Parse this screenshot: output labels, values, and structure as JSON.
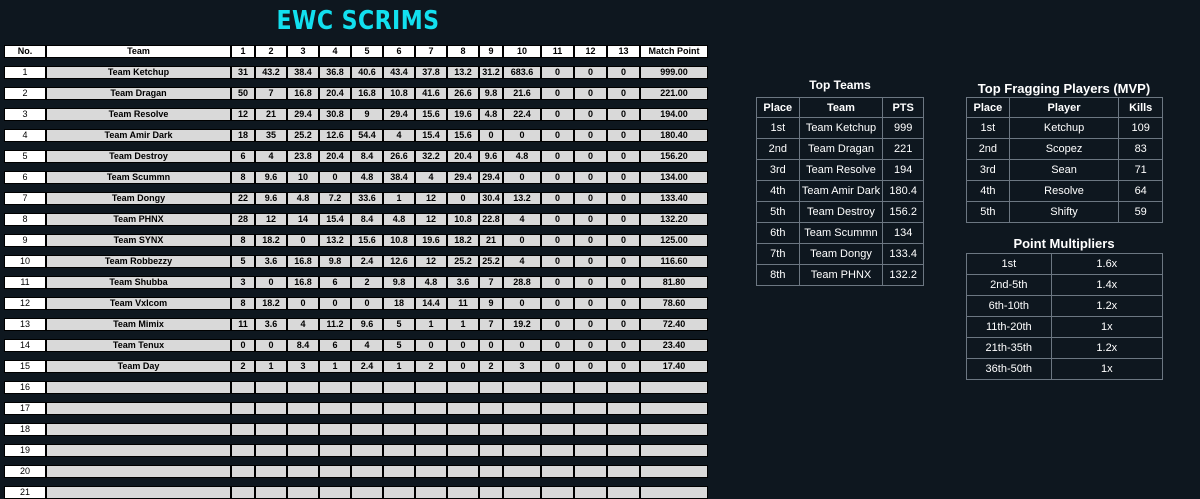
{
  "title": "EWC SCRIMS",
  "standings": {
    "headers": [
      "No.",
      "Team",
      "1",
      "2",
      "3",
      "4",
      "5",
      "6",
      "7",
      "8",
      "9",
      "10",
      "11",
      "12",
      "13",
      "Match Point"
    ],
    "rows": [
      {
        "no": "1",
        "team": "Team Ketchup",
        "g": [
          "31",
          "43.2",
          "38.4",
          "36.8",
          "40.6",
          "43.4",
          "37.8",
          "13.2",
          "31.2",
          "683.6",
          "0",
          "0",
          "0"
        ],
        "mp": "999.00"
      },
      {
        "no": "2",
        "team": "Team Dragan",
        "g": [
          "50",
          "7",
          "16.8",
          "20.4",
          "16.8",
          "10.8",
          "41.6",
          "26.6",
          "9.8",
          "21.6",
          "0",
          "0",
          "0"
        ],
        "mp": "221.00"
      },
      {
        "no": "3",
        "team": "Team Resolve",
        "g": [
          "12",
          "21",
          "29.4",
          "30.8",
          "9",
          "29.4",
          "15.6",
          "19.6",
          "4.8",
          "22.4",
          "0",
          "0",
          "0"
        ],
        "mp": "194.00"
      },
      {
        "no": "4",
        "team": "Team Amir Dark",
        "g": [
          "18",
          "35",
          "25.2",
          "12.6",
          "54.4",
          "4",
          "15.4",
          "15.6",
          "0",
          "0",
          "0",
          "0",
          "0"
        ],
        "mp": "180.40"
      },
      {
        "no": "5",
        "team": "Team Destroy",
        "g": [
          "6",
          "4",
          "23.8",
          "20.4",
          "8.4",
          "26.6",
          "32.2",
          "20.4",
          "9.6",
          "4.8",
          "0",
          "0",
          "0"
        ],
        "mp": "156.20"
      },
      {
        "no": "6",
        "team": "Team Scummn",
        "g": [
          "8",
          "9.6",
          "10",
          "0",
          "4.8",
          "38.4",
          "4",
          "29.4",
          "29.4",
          "0",
          "0",
          "0",
          "0"
        ],
        "mp": "134.00"
      },
      {
        "no": "7",
        "team": "Team Dongy",
        "g": [
          "22",
          "9.6",
          "4.8",
          "7.2",
          "33.6",
          "1",
          "12",
          "0",
          "30.4",
          "13.2",
          "0",
          "0",
          "0"
        ],
        "mp": "133.40"
      },
      {
        "no": "8",
        "team": "Team PHNX",
        "g": [
          "28",
          "12",
          "14",
          "15.4",
          "8.4",
          "4.8",
          "12",
          "10.8",
          "22.8",
          "4",
          "0",
          "0",
          "0"
        ],
        "mp": "132.20"
      },
      {
        "no": "9",
        "team": "Team SYNX",
        "g": [
          "8",
          "18.2",
          "0",
          "13.2",
          "15.6",
          "10.8",
          "19.6",
          "18.2",
          "21",
          "0",
          "0",
          "0",
          "0"
        ],
        "mp": "125.00"
      },
      {
        "no": "10",
        "team": "Team Robbezzy",
        "g": [
          "5",
          "3.6",
          "16.8",
          "9.8",
          "2.4",
          "12.6",
          "12",
          "25.2",
          "25.2",
          "4",
          "0",
          "0",
          "0"
        ],
        "mp": "116.60"
      },
      {
        "no": "11",
        "team": "Team Shubba",
        "g": [
          "3",
          "0",
          "16.8",
          "6",
          "2",
          "9.8",
          "4.8",
          "3.6",
          "7",
          "28.8",
          "0",
          "0",
          "0"
        ],
        "mp": "81.80"
      },
      {
        "no": "12",
        "team": "Team Vxlcom",
        "g": [
          "8",
          "18.2",
          "0",
          "0",
          "0",
          "18",
          "14.4",
          "11",
          "9",
          "0",
          "0",
          "0",
          "0"
        ],
        "mp": "78.60"
      },
      {
        "no": "13",
        "team": "Team Mimix",
        "g": [
          "11",
          "3.6",
          "4",
          "11.2",
          "9.6",
          "5",
          "1",
          "1",
          "7",
          "19.2",
          "0",
          "0",
          "0"
        ],
        "mp": "72.40"
      },
      {
        "no": "14",
        "team": "Team Tenux",
        "g": [
          "0",
          "0",
          "8.4",
          "6",
          "4",
          "5",
          "0",
          "0",
          "0",
          "0",
          "0",
          "0",
          "0"
        ],
        "mp": "23.40"
      },
      {
        "no": "15",
        "team": "Team Day",
        "g": [
          "2",
          "1",
          "3",
          "1",
          "2.4",
          "1",
          "2",
          "0",
          "2",
          "3",
          "0",
          "0",
          "0"
        ],
        "mp": "17.40"
      },
      {
        "no": "16",
        "team": "",
        "g": [
          "",
          "",
          "",
          "",
          "",
          "",
          "",
          "",
          "",
          "",
          "",
          "",
          ""
        ],
        "mp": ""
      },
      {
        "no": "17",
        "team": "",
        "g": [
          "",
          "",
          "",
          "",
          "",
          "",
          "",
          "",
          "",
          "",
          "",
          "",
          ""
        ],
        "mp": ""
      },
      {
        "no": "18",
        "team": "",
        "g": [
          "",
          "",
          "",
          "",
          "",
          "",
          "",
          "",
          "",
          "",
          "",
          "",
          ""
        ],
        "mp": ""
      },
      {
        "no": "19",
        "team": "",
        "g": [
          "",
          "",
          "",
          "",
          "",
          "",
          "",
          "",
          "",
          "",
          "",
          "",
          ""
        ],
        "mp": ""
      },
      {
        "no": "20",
        "team": "",
        "g": [
          "",
          "",
          "",
          "",
          "",
          "",
          "",
          "",
          "",
          "",
          "",
          "",
          ""
        ],
        "mp": ""
      },
      {
        "no": "21",
        "team": "",
        "g": [
          "",
          "",
          "",
          "",
          "",
          "",
          "",
          "",
          "",
          "",
          "",
          "",
          ""
        ],
        "mp": ""
      }
    ]
  },
  "top_teams": {
    "title": "Top Teams",
    "headers": [
      "Place",
      "Team",
      "PTS"
    ],
    "rows": [
      [
        "1st",
        "Team Ketchup",
        "999"
      ],
      [
        "2nd",
        "Team Dragan",
        "221"
      ],
      [
        "3rd",
        "Team Resolve",
        "194"
      ],
      [
        "4th",
        "Team Amir Dark",
        "180.4"
      ],
      [
        "5th",
        "Team Destroy",
        "156.2"
      ],
      [
        "6th",
        "Team Scummn",
        "134"
      ],
      [
        "7th",
        "Team Dongy",
        "133.4"
      ],
      [
        "8th",
        "Team PHNX",
        "132.2"
      ]
    ]
  },
  "top_fraggers": {
    "title": "Top Fragging Players (MVP)",
    "headers": [
      "Place",
      "Player",
      "Kills"
    ],
    "rows": [
      [
        "1st",
        "Ketchup",
        "109"
      ],
      [
        "2nd",
        "Scopez",
        "83"
      ],
      [
        "3rd",
        "Sean",
        "71"
      ],
      [
        "4th",
        "Resolve",
        "64"
      ],
      [
        "5th",
        "Shifty",
        "59"
      ]
    ]
  },
  "multipliers": {
    "title": "Point Multipliers",
    "rows": [
      [
        "1st",
        "1.6x"
      ],
      [
        "2nd-5th",
        "1.4x"
      ],
      [
        "6th-10th",
        "1.2x"
      ],
      [
        "11th-20th",
        "1x"
      ],
      [
        "21th-35th",
        "1.2x"
      ],
      [
        "36th-50th",
        "1x"
      ]
    ]
  }
}
